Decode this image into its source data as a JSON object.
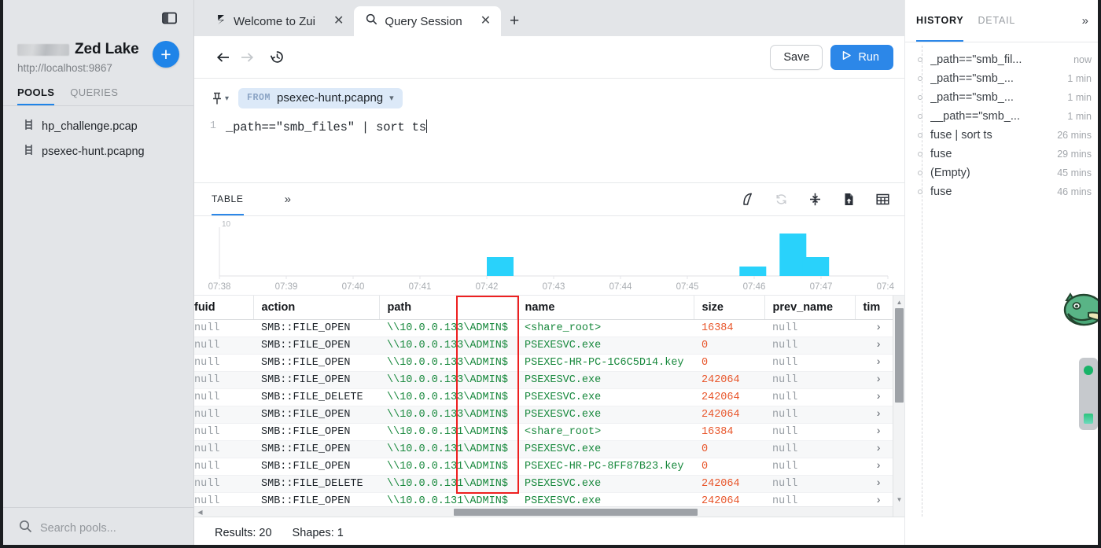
{
  "window": {
    "panel_toggle_icon": "sidebar-toggle-icon"
  },
  "sidebar": {
    "brand_name": "Zed Lake",
    "brand_url": "http://localhost:9867",
    "add_button_label": "+",
    "tabs": [
      {
        "label": "POOLS",
        "active": true
      },
      {
        "label": "QUERIES",
        "active": false
      }
    ],
    "pools": [
      {
        "label": "hp_challenge.pcap",
        "icon": "pool-icon"
      },
      {
        "label": "psexec-hunt.pcapng",
        "icon": "pool-icon"
      }
    ],
    "search": {
      "placeholder": "Search pools...",
      "value": "",
      "icon": "search-icon"
    }
  },
  "tabbar": {
    "tabs": [
      {
        "title": "Welcome to Zui",
        "icon": "zui-logo-icon",
        "active": false,
        "close": "✕"
      },
      {
        "title": "Query Session",
        "icon": "search-icon",
        "active": true,
        "close": "✕"
      }
    ],
    "new_tab_label": "+"
  },
  "navrow": {
    "back_icon": "arrow-left-icon",
    "forward_icon": "arrow-right-icon",
    "history_icon": "clock-history-icon",
    "save_label": "Save",
    "run_label": "Run",
    "run_icon": "play-icon"
  },
  "editor": {
    "pin_icon": "pin-icon",
    "from_keyword": "FROM",
    "from_pool": "psexec-hunt.pcapng",
    "from_caret_icon": "chevron-down-icon",
    "line_number": "1",
    "query": "_path==\"smb_files\" | sort ts"
  },
  "results_toolbar": {
    "tab_label": "TABLE",
    "more_label": "»",
    "icons": [
      "shark-fin-icon",
      "refresh-icon",
      "collapse-vertical-icon",
      "file-export-icon",
      "table-grid-icon"
    ]
  },
  "chart_data": {
    "type": "bar",
    "title": "",
    "xlabel": "",
    "ylabel": "",
    "ylim": [
      0,
      10
    ],
    "ytick_labels": [
      "10"
    ],
    "grid": false,
    "legend": false,
    "xtick_labels": [
      "07:38",
      "07:39",
      "07:40",
      "07:41",
      "07:42",
      "07:43",
      "07:44",
      "07:45",
      "07:46",
      "07:47",
      "07:48"
    ],
    "x": [
      "07:42",
      "07:45:45",
      "07:46:20",
      "07:46:40"
    ],
    "values": [
      4,
      2,
      9,
      4
    ],
    "bar_color": "#29d2fb"
  },
  "table": {
    "columns": [
      "fuid",
      "action",
      "path",
      "name",
      "size",
      "prev_name",
      "tim"
    ],
    "rows": [
      {
        "fuid": "null",
        "action": "SMB::FILE_OPEN",
        "path": "\\\\10.0.0.133\\ADMIN$",
        "name": "<share_root>",
        "size": "16384",
        "prev_name": "null",
        "chev": "›"
      },
      {
        "fuid": "null",
        "action": "SMB::FILE_OPEN",
        "path": "\\\\10.0.0.133\\ADMIN$",
        "name": "PSEXESVC.exe",
        "size": "0",
        "prev_name": "null",
        "chev": "›"
      },
      {
        "fuid": "null",
        "action": "SMB::FILE_OPEN",
        "path": "\\\\10.0.0.133\\ADMIN$",
        "name": "PSEXEC-HR-PC-1C6C5D14.key",
        "size": "0",
        "prev_name": "null",
        "chev": "›"
      },
      {
        "fuid": "null",
        "action": "SMB::FILE_OPEN",
        "path": "\\\\10.0.0.133\\ADMIN$",
        "name": "PSEXESVC.exe",
        "size": "242064",
        "prev_name": "null",
        "chev": "›"
      },
      {
        "fuid": "null",
        "action": "SMB::FILE_DELETE",
        "path": "\\\\10.0.0.133\\ADMIN$",
        "name": "PSEXESVC.exe",
        "size": "242064",
        "prev_name": "null",
        "chev": "›"
      },
      {
        "fuid": "null",
        "action": "SMB::FILE_OPEN",
        "path": "\\\\10.0.0.133\\ADMIN$",
        "name": "PSEXESVC.exe",
        "size": "242064",
        "prev_name": "null",
        "chev": "›"
      },
      {
        "fuid": "null",
        "action": "SMB::FILE_OPEN",
        "path": "\\\\10.0.0.131\\ADMIN$",
        "name": "<share_root>",
        "size": "16384",
        "prev_name": "null",
        "chev": "›"
      },
      {
        "fuid": "null",
        "action": "SMB::FILE_OPEN",
        "path": "\\\\10.0.0.131\\ADMIN$",
        "name": "PSEXESVC.exe",
        "size": "0",
        "prev_name": "null",
        "chev": "›"
      },
      {
        "fuid": "null",
        "action": "SMB::FILE_OPEN",
        "path": "\\\\10.0.0.131\\ADMIN$",
        "name": "PSEXEC-HR-PC-8FF87B23.key",
        "size": "0",
        "prev_name": "null",
        "chev": "›"
      },
      {
        "fuid": "null",
        "action": "SMB::FILE_DELETE",
        "path": "\\\\10.0.0.131\\ADMIN$",
        "name": "PSEXESVC.exe",
        "size": "242064",
        "prev_name": "null",
        "chev": "›"
      },
      {
        "fuid": "null",
        "action": "SMB::FILE_OPEN",
        "path": "\\\\10.0.0.131\\ADMIN$",
        "name": "PSEXESVC.exe",
        "size": "242064",
        "prev_name": "null",
        "chev": "›"
      }
    ],
    "annotation_color": "#ee2020"
  },
  "statusbar": {
    "results_label": "Results: 20",
    "shapes_label": "Shapes: 1"
  },
  "right_panel": {
    "tabs": [
      {
        "label": "HISTORY",
        "active": true
      },
      {
        "label": "DETAIL",
        "active": false
      }
    ],
    "collapse_label": "»",
    "history": [
      {
        "query": "_path==\"smb_fil...",
        "time": "now"
      },
      {
        "query": "_path==\"smb_...",
        "time": "1 min"
      },
      {
        "query": "_path==\"smb_...",
        "time": "1 min"
      },
      {
        "query": "__path==\"smb_...",
        "time": "1 min"
      },
      {
        "query": "fuse | sort ts",
        "time": "26 mins"
      },
      {
        "query": "fuse",
        "time": "29 mins"
      },
      {
        "query": "(Empty)",
        "time": "45 mins"
      },
      {
        "query": "fuse",
        "time": "46 mins"
      }
    ]
  },
  "colors": {
    "accent": "#2c87e8",
    "bar": "#29d2fb",
    "string": "#17883c",
    "number": "#e8562b",
    "null": "#9aa0a6"
  }
}
